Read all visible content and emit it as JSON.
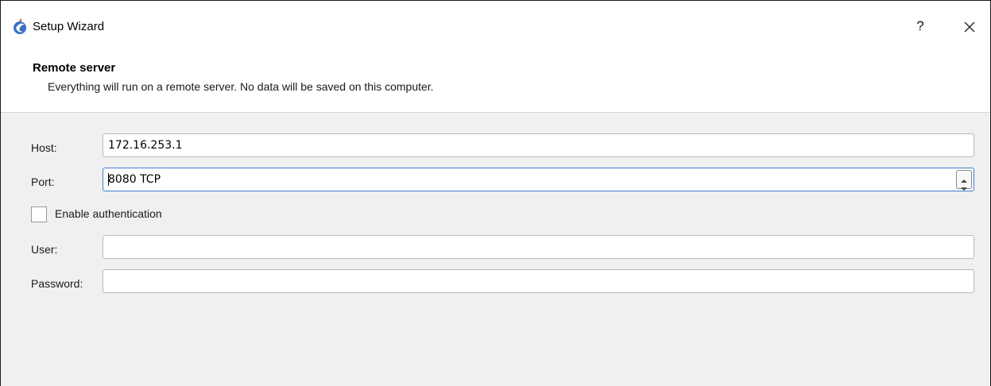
{
  "window": {
    "title": "Setup Wizard",
    "help_label": "?",
    "icon": "app-logo-icon",
    "close_icon": "close-icon"
  },
  "header": {
    "title": "Remote server",
    "subtitle": "Everything will run on a remote server. No data will be saved on this computer."
  },
  "form": {
    "host": {
      "label": "Host:",
      "value": "172.16.253.1"
    },
    "port": {
      "label": "Port:",
      "value": "8080 TCP",
      "focused": true
    },
    "auth": {
      "label": "Enable authentication",
      "checked": false
    },
    "user": {
      "label": "User:",
      "value": ""
    },
    "password": {
      "label": "Password:",
      "value": ""
    }
  },
  "colors": {
    "content_bg": "#f0f0f0",
    "focus_border": "#3b7fd1",
    "icon_blue": "#3a6fc9"
  }
}
